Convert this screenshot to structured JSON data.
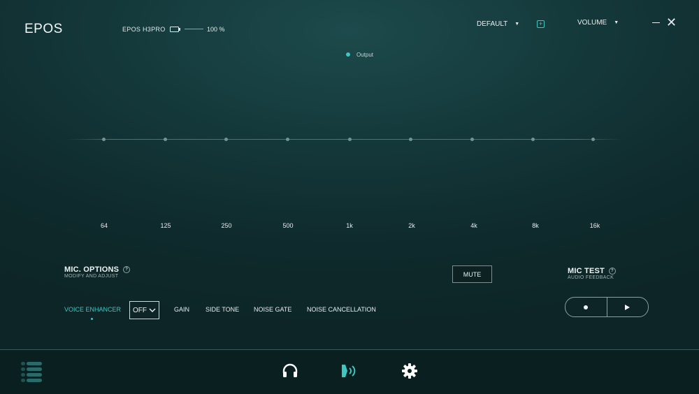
{
  "app": {
    "logo": "EPOS"
  },
  "device": {
    "name": "EPOS H3PRO",
    "battery": "100 %"
  },
  "header": {
    "preset": "DEFAULT",
    "volume": "VOLUME"
  },
  "equalizer": {
    "legend": "Output",
    "frequencies": [
      "64",
      "125",
      "250",
      "500",
      "1k",
      "2k",
      "4k",
      "8k",
      "16k"
    ]
  },
  "mic_options": {
    "title": "MIC. OPTIONS",
    "subtitle": "MODIFY AND ADJUST",
    "help": "?",
    "mute": "MUTE",
    "tabs": [
      "VOICE ENHANCER",
      "GAIN",
      "SIDE TONE",
      "NOISE GATE",
      "NOISE CANCELLATION"
    ],
    "voice_enhancer_value": "OFF"
  },
  "mic_test": {
    "title": "MIC TEST",
    "subtitle": "AUDIO FEEDBACK",
    "help": "?"
  },
  "colors": {
    "accent": "#3ec6c0",
    "background": "#153a3c",
    "footer": "#0a1f20"
  },
  "icons": {
    "menu": "menu-bars-icon",
    "headphones": "headphones-icon",
    "microphone": "microphone-sound-icon",
    "settings": "gear-icon"
  }
}
